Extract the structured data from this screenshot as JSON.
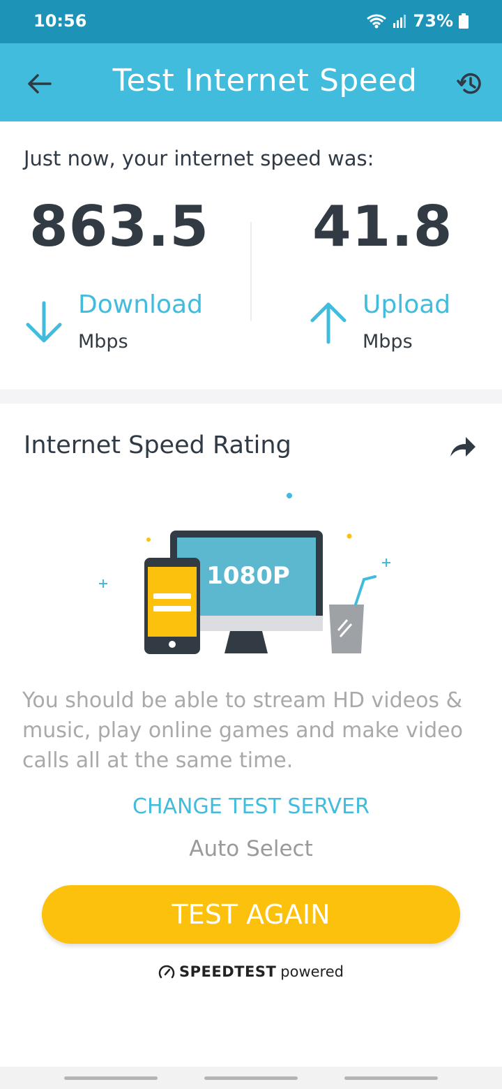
{
  "status_bar": {
    "time": "10:56",
    "battery": "73%"
  },
  "app_bar": {
    "title": "Test Internet Speed",
    "back_icon": "back-arrow-icon",
    "history_icon": "history-icon"
  },
  "result": {
    "heading": "Just now, your internet speed was:",
    "download": {
      "value": "863.5",
      "label": "Download",
      "unit": "Mbps",
      "icon": "download-arrow-icon"
    },
    "upload": {
      "value": "41.8",
      "label": "Upload",
      "unit": "Mbps",
      "icon": "upload-arrow-icon"
    }
  },
  "rating": {
    "title": "Internet Speed Rating",
    "share_icon": "share-icon",
    "illustration": {
      "screen_text": "1080P"
    },
    "description": "You should be able to stream HD videos & music, play online games and make video calls all at the same time.",
    "change_server_label": "CHANGE TEST SERVER",
    "server_value": "Auto Select",
    "test_again_label": "TEST AGAIN",
    "powered_brand": "SPEEDTEST",
    "powered_suffix": "powered"
  },
  "colors": {
    "status_bar": "#1e93b8",
    "app_bar": "#42bcdc",
    "accent": "#42bcdc",
    "button": "#fcc10c",
    "text_dark": "#2f3a45",
    "text_muted": "#a9a9a9"
  }
}
